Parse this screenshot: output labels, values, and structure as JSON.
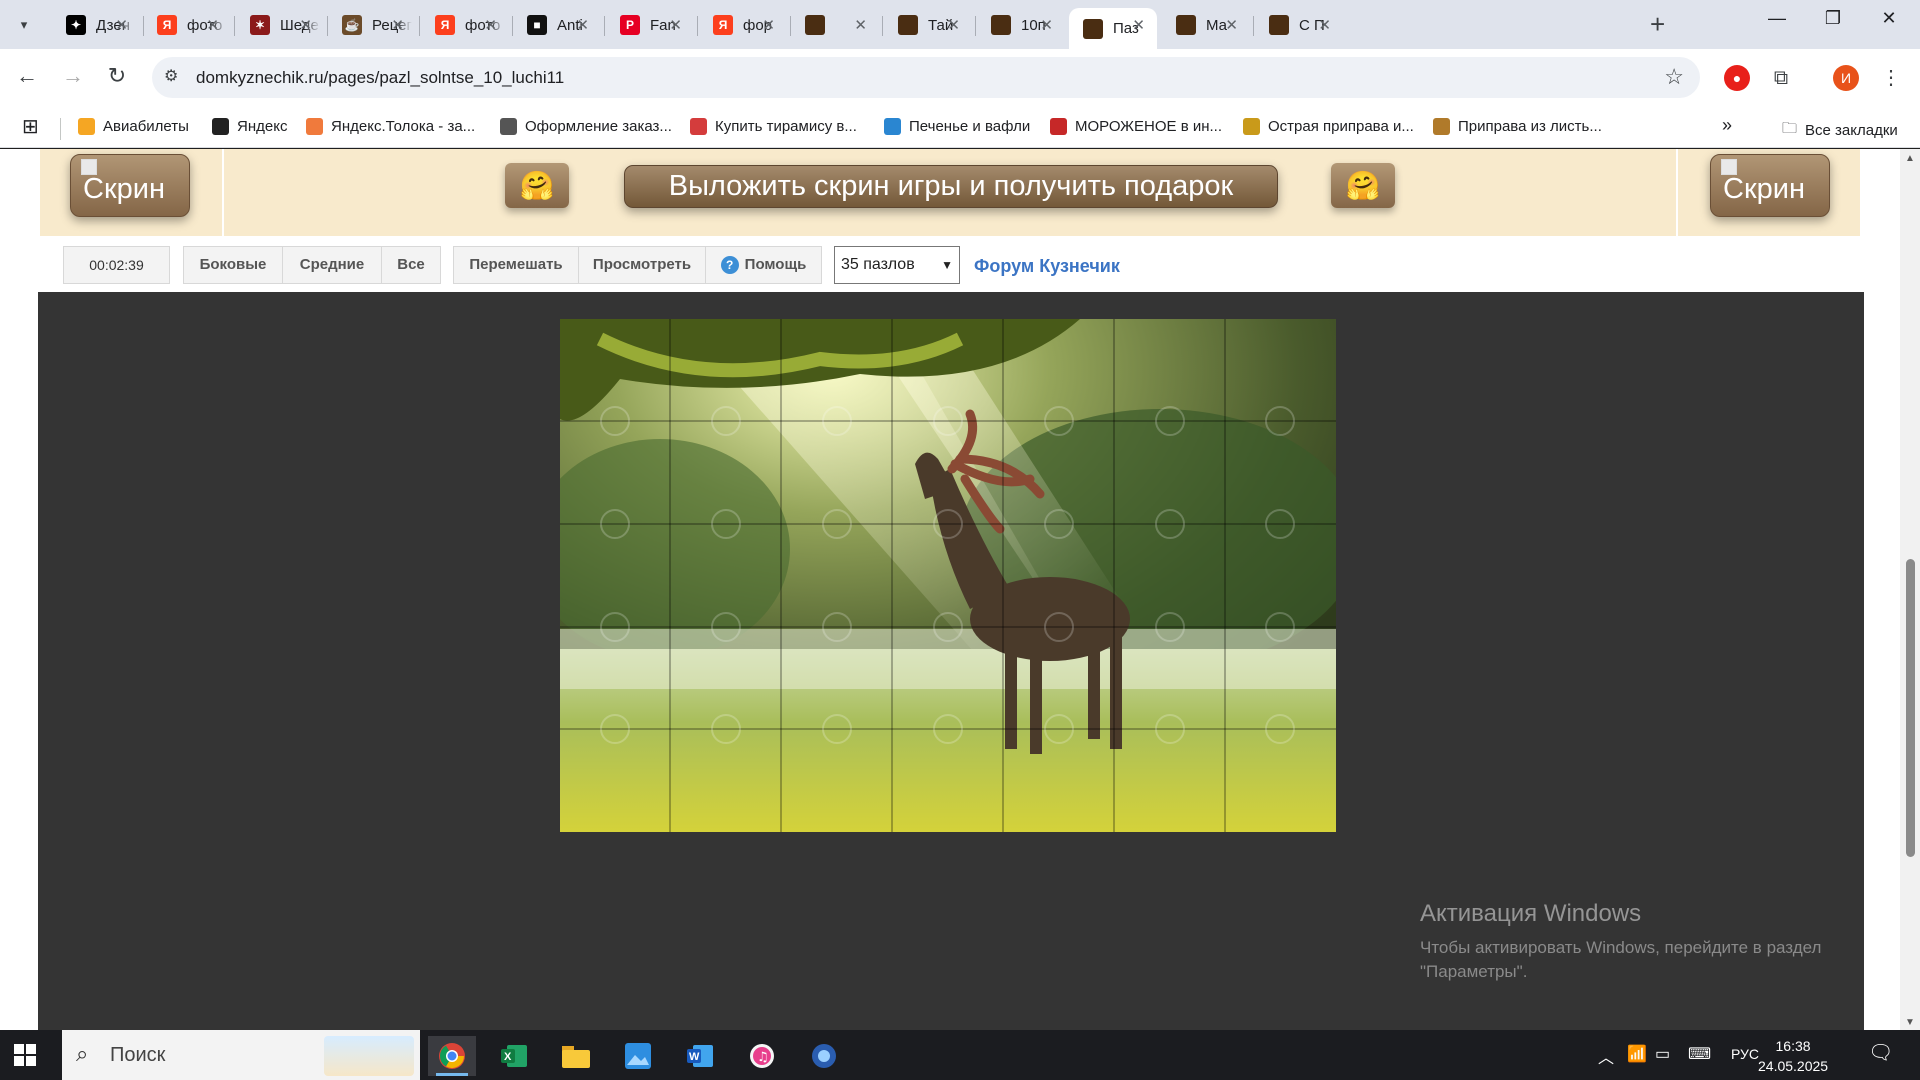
{
  "tabs": [
    {
      "title": "Дзен",
      "icon": "dzen-icon",
      "color": "#000000",
      "glyph": "✦"
    },
    {
      "title": "фото",
      "icon": "yandex-icon",
      "color": "#fc3f1d",
      "glyph": "Я"
    },
    {
      "title": "Шедевр",
      "icon": "site-icon",
      "color": "#8b1a1a",
      "glyph": "✶"
    },
    {
      "title": "Рецепт",
      "icon": "recipe-icon",
      "color": "#6b4b2a",
      "glyph": "☕"
    },
    {
      "title": "фото",
      "icon": "yandex-icon",
      "color": "#fc3f1d",
      "glyph": "Я"
    },
    {
      "title": "Anti",
      "icon": "anti-icon",
      "color": "#111111",
      "glyph": "■"
    },
    {
      "title": "Fan",
      "icon": "pinterest-icon",
      "color": "#e60023",
      "glyph": "P"
    },
    {
      "title": "фор",
      "icon": "yandex-icon",
      "color": "#fc3f1d",
      "glyph": "Я"
    },
    {
      "title": "",
      "icon": "domkyznechik-icon",
      "color": "#4a2d12",
      "glyph": ""
    },
    {
      "title": "Тай",
      "icon": "domkyznechik-icon",
      "color": "#4a2d12",
      "glyph": ""
    },
    {
      "title": "10п",
      "icon": "domkyznechik-icon",
      "color": "#4a2d12",
      "glyph": ""
    },
    {
      "title": "Паз",
      "icon": "domkyznechik-icon",
      "color": "#4a2d12",
      "glyph": ""
    },
    {
      "title": "Ма",
      "icon": "domkyznechik-icon",
      "color": "#4a2d12",
      "glyph": ""
    },
    {
      "title": "С П",
      "icon": "domkyznechik-icon",
      "color": "#4a2d12",
      "glyph": ""
    }
  ],
  "active_tab_index": 11,
  "url": "domkyznechik.ru/pages/pazl_solntse_10_luchi11",
  "bookmarks": [
    {
      "label": "Авиабилеты",
      "color": "#f5a623"
    },
    {
      "label": "Яндекс",
      "color": "#222222"
    },
    {
      "label": "Яндекс.Толока - за...",
      "color": "#f07a3c"
    },
    {
      "label": "Оформление заказ...",
      "color": "#555555"
    },
    {
      "label": "Купить тирамису в...",
      "color": "#d43c3c"
    },
    {
      "label": "Печенье и вафли",
      "color": "#2a86d1"
    },
    {
      "label": "МОРОЖЕНОЕ в ин...",
      "color": "#c62828"
    },
    {
      "label": "Острая приправа и...",
      "color": "#c99a1a"
    },
    {
      "label": "Приправа из листь...",
      "color": "#b07a2a"
    }
  ],
  "all_bookmarks": "Все закладки",
  "profile_letter": "И",
  "banner": {
    "left_button": "Скрин",
    "right_button": "Скрин",
    "promo": "Выложить скрин игры и получить подарок",
    "emoji": "🤗"
  },
  "toolbar": {
    "timer": "00:02:39",
    "edges": "Боковые",
    "middle": "Средние",
    "all": "Все",
    "shuffle": "Перемешать",
    "preview": "Просмотреть",
    "help": "Помощь",
    "pieces": "35 пазлов",
    "forum": "Форум Кузнечик"
  },
  "puzzle": {
    "cols": 7,
    "rows": 5
  },
  "watermark": {
    "title": "Активация Windows",
    "text": "Чтобы активировать Windows, перейдите в раздел \"Параметры\"."
  },
  "taskbar": {
    "search": "Поиск",
    "lang": "РУС",
    "time": "16:38",
    "date": "24.05.2025"
  },
  "colors": {
    "accent": "#3b74c4",
    "banner": "#f8eacc",
    "board": "#343434"
  }
}
